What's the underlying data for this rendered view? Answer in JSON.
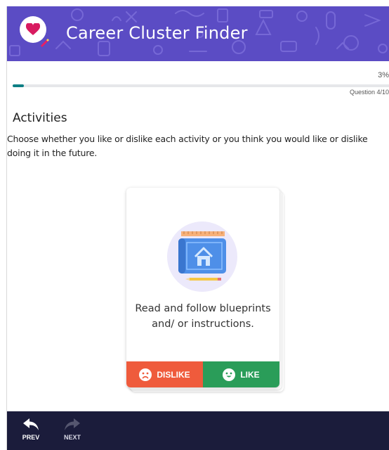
{
  "header": {
    "title": "Career Cluster Finder",
    "background_color": "#5b4cc4"
  },
  "progress": {
    "percent_label": "3%",
    "percent": 3,
    "question_label": "Question 4/10",
    "fill_color": "#0e7f85"
  },
  "section": {
    "title": "Activities",
    "description": "Choose whether you like or dislike each activity or you think you would like or dislike doing it in the future."
  },
  "card": {
    "icon": "blueprint-house-icon",
    "text": "Read and follow blueprints and/ or instructions.",
    "dislike_label": "DISLIKE",
    "like_label": "LIKE",
    "dislike_color": "#ef5b3c",
    "like_color": "#2a9d59"
  },
  "footer": {
    "prev_label": "PREV",
    "next_label": "NEXT"
  }
}
